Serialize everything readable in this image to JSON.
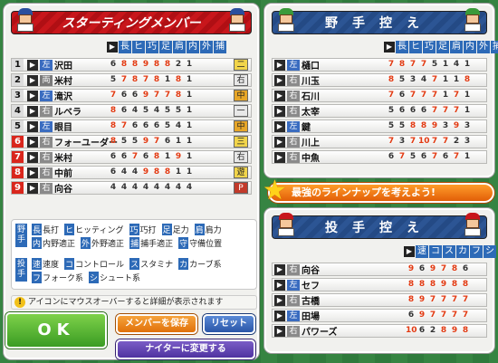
{
  "starting": {
    "title": "スターティングメンバー",
    "headers": [
      "長",
      "ヒ",
      "巧",
      "足",
      "肩",
      "内",
      "外",
      "捕"
    ],
    "players": [
      {
        "no": "1",
        "hand": "左",
        "name": "沢田",
        "stats": [
          "6",
          "8",
          "8",
          "9",
          "8",
          "8",
          "2",
          "1"
        ],
        "pos": "二"
      },
      {
        "no": "2",
        "hand": "両",
        "name": "米村",
        "stats": [
          "5",
          "7",
          "8",
          "7",
          "8",
          "1",
          "8",
          "1"
        ],
        "pos": "右"
      },
      {
        "no": "3",
        "hand": "左",
        "name": "滝沢",
        "stats": [
          "7",
          "6",
          "6",
          "9",
          "7",
          "7",
          "8",
          "1"
        ],
        "pos": "中"
      },
      {
        "no": "4",
        "hand": "右",
        "name": "ルベラ",
        "stats": [
          "8",
          "6",
          "4",
          "5",
          "4",
          "5",
          "5",
          "1"
        ],
        "pos": "一"
      },
      {
        "no": "5",
        "hand": "左",
        "name": "眼目",
        "stats": [
          "8",
          "7",
          "6",
          "6",
          "6",
          "5",
          "4",
          "1"
        ],
        "pos": "中"
      },
      {
        "no": "6",
        "hand": "右",
        "name": "フォーユーダー",
        "stats": [
          "8",
          "5",
          "5",
          "9",
          "7",
          "6",
          "1",
          "1"
        ],
        "pos": "三"
      },
      {
        "no": "7",
        "hand": "右",
        "name": "米村",
        "stats": [
          "6",
          "6",
          "7",
          "6",
          "8",
          "1",
          "9",
          "1"
        ],
        "pos": "右"
      },
      {
        "no": "8",
        "hand": "右",
        "name": "中前",
        "stats": [
          "6",
          "4",
          "4",
          "9",
          "8",
          "8",
          "1",
          "1"
        ],
        "pos": "遊"
      },
      {
        "no": "9",
        "hand": "右",
        "name": "向谷",
        "stats": [
          "4",
          "4",
          "4",
          "4",
          "4",
          "4",
          "4",
          "4"
        ],
        "pos": "P"
      }
    ]
  },
  "bench": {
    "title": "野手控え",
    "headers": [
      "長",
      "ヒ",
      "巧",
      "足",
      "肩",
      "内",
      "外",
      "捕"
    ],
    "players": [
      {
        "hand": "左",
        "name": "樋口",
        "stats": [
          "7",
          "8",
          "7",
          "7",
          "5",
          "1",
          "4",
          "1"
        ]
      },
      {
        "hand": "右",
        "name": "川玉",
        "stats": [
          "8",
          "5",
          "3",
          "4",
          "7",
          "1",
          "1",
          "8"
        ]
      },
      {
        "hand": "右",
        "name": "石川",
        "stats": [
          "7",
          "6",
          "7",
          "7",
          "7",
          "1",
          "7",
          "1"
        ]
      },
      {
        "hand": "右",
        "name": "太宰",
        "stats": [
          "5",
          "6",
          "6",
          "6",
          "7",
          "7",
          "7",
          "1"
        ]
      },
      {
        "hand": "左",
        "name": "鍵",
        "stats": [
          "5",
          "5",
          "8",
          "8",
          "9",
          "3",
          "9",
          "3"
        ]
      },
      {
        "hand": "右",
        "name": "川上",
        "stats": [
          "7",
          "3",
          "7",
          "10",
          "7",
          "7",
          "2",
          "3"
        ]
      },
      {
        "hand": "右",
        "name": "中魚",
        "stats": [
          "6",
          "7",
          "5",
          "6",
          "7",
          "6",
          "7",
          "1"
        ]
      }
    ]
  },
  "pitchers": {
    "title": "投手控え",
    "headers": [
      "速",
      "コ",
      "ス",
      "カ",
      "フ",
      "シ"
    ],
    "players": [
      {
        "hand": "右",
        "name": "向谷",
        "stats": [
          "9",
          "6",
          "9",
          "7",
          "8",
          "6"
        ]
      },
      {
        "hand": "左",
        "name": "セフ",
        "stats": [
          "8",
          "8",
          "8",
          "9",
          "8",
          "8"
        ]
      },
      {
        "hand": "右",
        "name": "古橋",
        "stats": [
          "8",
          "9",
          "7",
          "7",
          "7",
          "7"
        ]
      },
      {
        "hand": "左",
        "name": "田場",
        "stats": [
          "6",
          "9",
          "7",
          "7",
          "7",
          "7"
        ]
      },
      {
        "hand": "右",
        "name": "パワーズ",
        "stats": [
          "10",
          "6",
          "2",
          "8",
          "9",
          "8"
        ]
      }
    ]
  },
  "banner": "最強のラインナップを考えよう!",
  "legend": {
    "fielder_tag": "野手",
    "pitcher_tag": "投手",
    "line1": [
      [
        "長",
        "長打"
      ],
      [
        "ヒ",
        "ヒッティング"
      ],
      [
        "巧",
        "巧打"
      ],
      [
        "足",
        "足力"
      ],
      [
        "肩",
        "肩力"
      ]
    ],
    "line2": [
      [
        "内",
        "内野適正"
      ],
      [
        "外",
        "外野適正"
      ],
      [
        "捕",
        "捕手適正"
      ],
      [
        "守",
        "守備位置"
      ]
    ],
    "line3": [
      [
        "速",
        "速度"
      ],
      [
        "コ",
        "コントロール"
      ],
      [
        "ス",
        "スタミナ"
      ],
      [
        "カ",
        "カーブ系"
      ]
    ],
    "line4": [
      [
        "フ",
        "フォーク系"
      ],
      [
        "シ",
        "シュート系"
      ]
    ]
  },
  "notice": "アイコンにマウスオーバーすると詳細が表示されます",
  "buttons": {
    "ok": "OK",
    "save": "メンバーを保存",
    "reset": "リセット",
    "night": "ナイターに変更する"
  }
}
